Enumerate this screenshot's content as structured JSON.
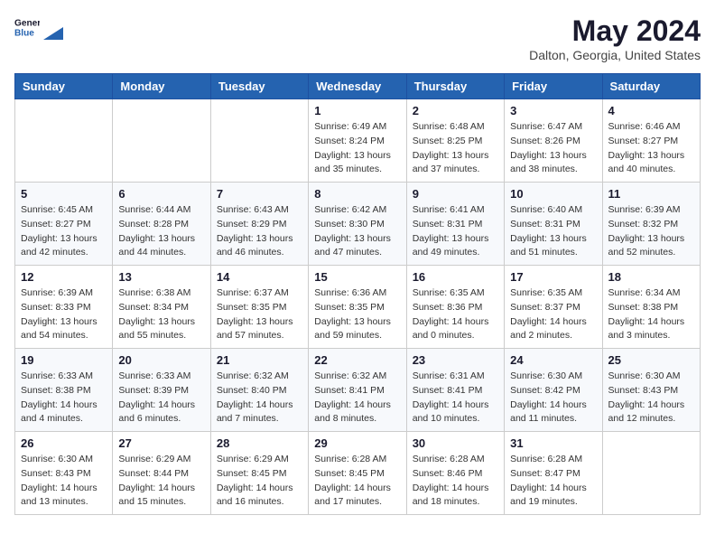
{
  "header": {
    "logo_general": "General",
    "logo_blue": "Blue",
    "main_title": "May 2024",
    "subtitle": "Dalton, Georgia, United States"
  },
  "calendar": {
    "days_of_week": [
      "Sunday",
      "Monday",
      "Tuesday",
      "Wednesday",
      "Thursday",
      "Friday",
      "Saturday"
    ],
    "weeks": [
      [
        {
          "day": "",
          "detail": ""
        },
        {
          "day": "",
          "detail": ""
        },
        {
          "day": "",
          "detail": ""
        },
        {
          "day": "1",
          "detail": "Sunrise: 6:49 AM\nSunset: 8:24 PM\nDaylight: 13 hours\nand 35 minutes."
        },
        {
          "day": "2",
          "detail": "Sunrise: 6:48 AM\nSunset: 8:25 PM\nDaylight: 13 hours\nand 37 minutes."
        },
        {
          "day": "3",
          "detail": "Sunrise: 6:47 AM\nSunset: 8:26 PM\nDaylight: 13 hours\nand 38 minutes."
        },
        {
          "day": "4",
          "detail": "Sunrise: 6:46 AM\nSunset: 8:27 PM\nDaylight: 13 hours\nand 40 minutes."
        }
      ],
      [
        {
          "day": "5",
          "detail": "Sunrise: 6:45 AM\nSunset: 8:27 PM\nDaylight: 13 hours\nand 42 minutes."
        },
        {
          "day": "6",
          "detail": "Sunrise: 6:44 AM\nSunset: 8:28 PM\nDaylight: 13 hours\nand 44 minutes."
        },
        {
          "day": "7",
          "detail": "Sunrise: 6:43 AM\nSunset: 8:29 PM\nDaylight: 13 hours\nand 46 minutes."
        },
        {
          "day": "8",
          "detail": "Sunrise: 6:42 AM\nSunset: 8:30 PM\nDaylight: 13 hours\nand 47 minutes."
        },
        {
          "day": "9",
          "detail": "Sunrise: 6:41 AM\nSunset: 8:31 PM\nDaylight: 13 hours\nand 49 minutes."
        },
        {
          "day": "10",
          "detail": "Sunrise: 6:40 AM\nSunset: 8:31 PM\nDaylight: 13 hours\nand 51 minutes."
        },
        {
          "day": "11",
          "detail": "Sunrise: 6:39 AM\nSunset: 8:32 PM\nDaylight: 13 hours\nand 52 minutes."
        }
      ],
      [
        {
          "day": "12",
          "detail": "Sunrise: 6:39 AM\nSunset: 8:33 PM\nDaylight: 13 hours\nand 54 minutes."
        },
        {
          "day": "13",
          "detail": "Sunrise: 6:38 AM\nSunset: 8:34 PM\nDaylight: 13 hours\nand 55 minutes."
        },
        {
          "day": "14",
          "detail": "Sunrise: 6:37 AM\nSunset: 8:35 PM\nDaylight: 13 hours\nand 57 minutes."
        },
        {
          "day": "15",
          "detail": "Sunrise: 6:36 AM\nSunset: 8:35 PM\nDaylight: 13 hours\nand 59 minutes."
        },
        {
          "day": "16",
          "detail": "Sunrise: 6:35 AM\nSunset: 8:36 PM\nDaylight: 14 hours\nand 0 minutes."
        },
        {
          "day": "17",
          "detail": "Sunrise: 6:35 AM\nSunset: 8:37 PM\nDaylight: 14 hours\nand 2 minutes."
        },
        {
          "day": "18",
          "detail": "Sunrise: 6:34 AM\nSunset: 8:38 PM\nDaylight: 14 hours\nand 3 minutes."
        }
      ],
      [
        {
          "day": "19",
          "detail": "Sunrise: 6:33 AM\nSunset: 8:38 PM\nDaylight: 14 hours\nand 4 minutes."
        },
        {
          "day": "20",
          "detail": "Sunrise: 6:33 AM\nSunset: 8:39 PM\nDaylight: 14 hours\nand 6 minutes."
        },
        {
          "day": "21",
          "detail": "Sunrise: 6:32 AM\nSunset: 8:40 PM\nDaylight: 14 hours\nand 7 minutes."
        },
        {
          "day": "22",
          "detail": "Sunrise: 6:32 AM\nSunset: 8:41 PM\nDaylight: 14 hours\nand 8 minutes."
        },
        {
          "day": "23",
          "detail": "Sunrise: 6:31 AM\nSunset: 8:41 PM\nDaylight: 14 hours\nand 10 minutes."
        },
        {
          "day": "24",
          "detail": "Sunrise: 6:30 AM\nSunset: 8:42 PM\nDaylight: 14 hours\nand 11 minutes."
        },
        {
          "day": "25",
          "detail": "Sunrise: 6:30 AM\nSunset: 8:43 PM\nDaylight: 14 hours\nand 12 minutes."
        }
      ],
      [
        {
          "day": "26",
          "detail": "Sunrise: 6:30 AM\nSunset: 8:43 PM\nDaylight: 14 hours\nand 13 minutes."
        },
        {
          "day": "27",
          "detail": "Sunrise: 6:29 AM\nSunset: 8:44 PM\nDaylight: 14 hours\nand 15 minutes."
        },
        {
          "day": "28",
          "detail": "Sunrise: 6:29 AM\nSunset: 8:45 PM\nDaylight: 14 hours\nand 16 minutes."
        },
        {
          "day": "29",
          "detail": "Sunrise: 6:28 AM\nSunset: 8:45 PM\nDaylight: 14 hours\nand 17 minutes."
        },
        {
          "day": "30",
          "detail": "Sunrise: 6:28 AM\nSunset: 8:46 PM\nDaylight: 14 hours\nand 18 minutes."
        },
        {
          "day": "31",
          "detail": "Sunrise: 6:28 AM\nSunset: 8:47 PM\nDaylight: 14 hours\nand 19 minutes."
        },
        {
          "day": "",
          "detail": ""
        }
      ]
    ]
  }
}
